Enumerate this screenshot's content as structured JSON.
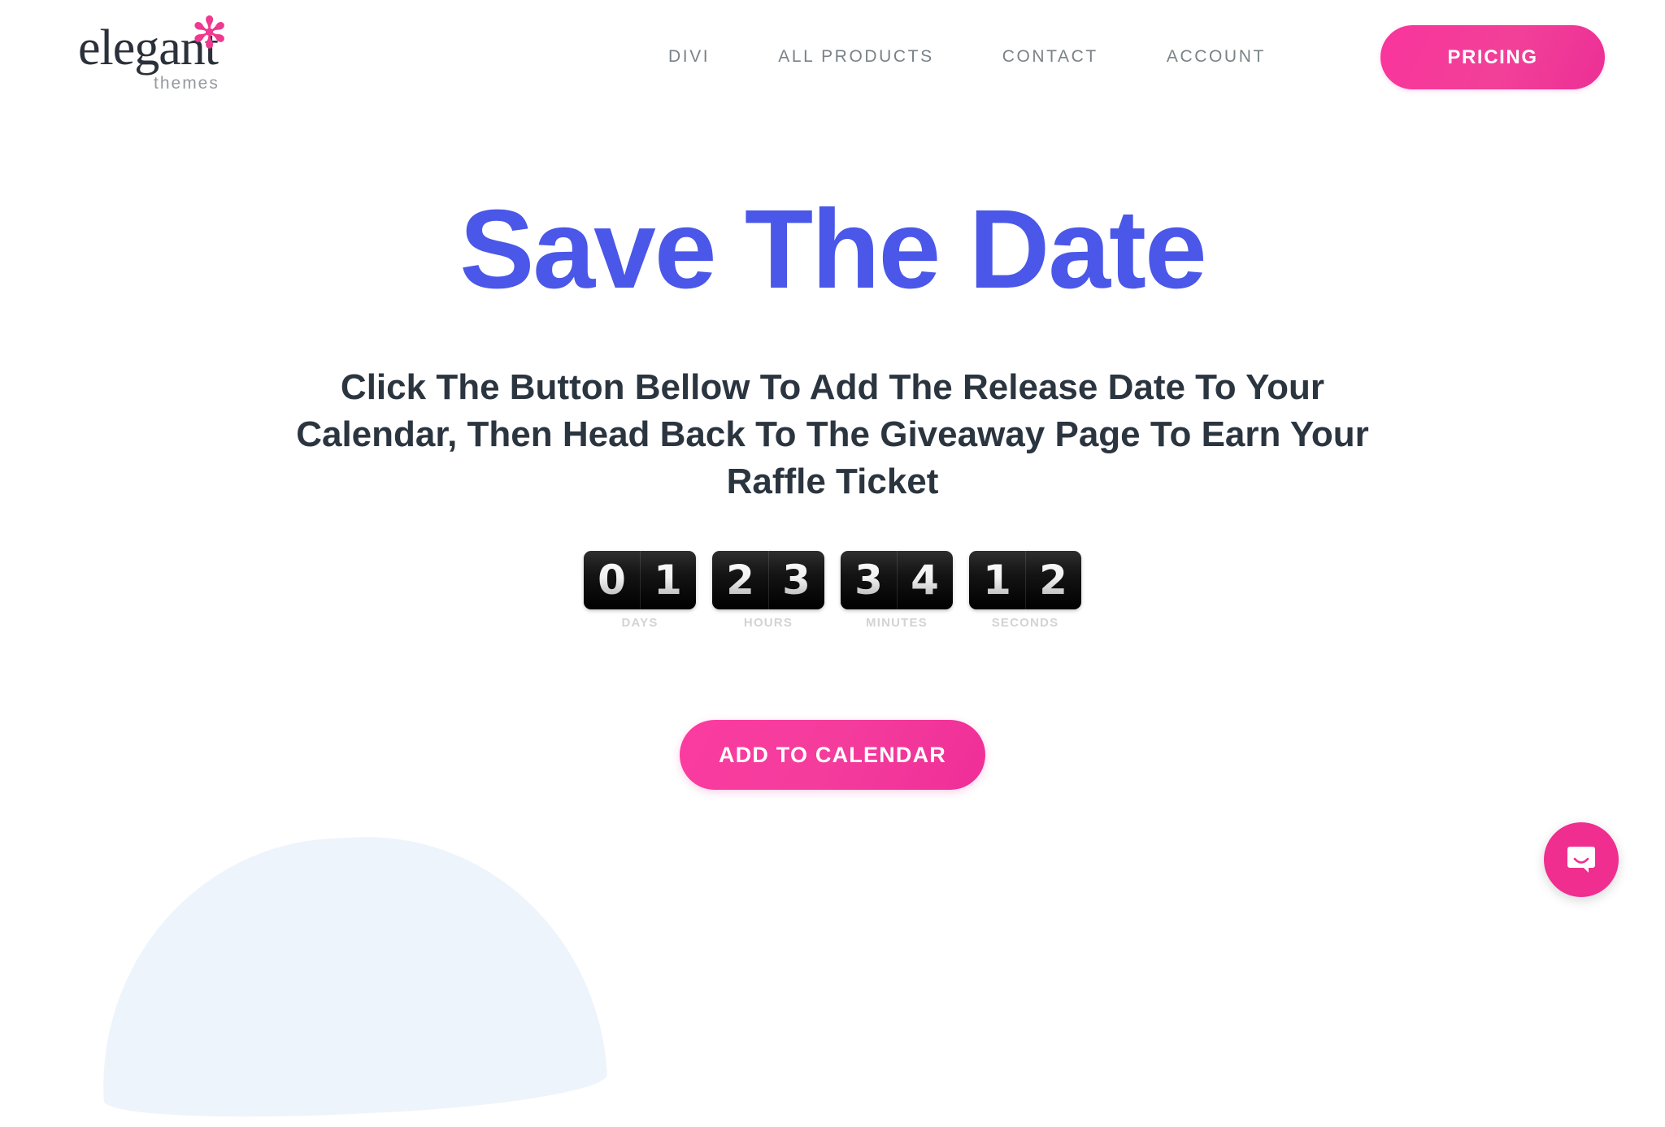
{
  "brand": {
    "logo_word": "elegant",
    "logo_star": "✻",
    "logo_sub": "themes",
    "accent_pink": "#ef2e98",
    "accent_blue": "#4a57e8",
    "text_dark": "#2b3540",
    "nav_gray": "#7a8287",
    "blob_blue": "#eef4fc"
  },
  "header": {
    "nav": [
      {
        "label": "DIVI",
        "name": "nav-item-divi"
      },
      {
        "label": "ALL PRODUCTS",
        "name": "nav-item-all-products"
      },
      {
        "label": "CONTACT",
        "name": "nav-item-contact"
      },
      {
        "label": "ACCOUNT",
        "name": "nav-item-account"
      }
    ],
    "pricing_label": "PRICING"
  },
  "hero": {
    "headline": "Save The Date",
    "subheadline": "Click The Button Bellow To Add The Release Date To Your Calendar, Then Head Back To The Giveaway Page To Earn Your Raffle Ticket",
    "cta_label": "ADD TO CALENDAR"
  },
  "countdown": {
    "units": [
      {
        "label": "DAYS",
        "value": "01",
        "d1": "0",
        "d2": "1"
      },
      {
        "label": "HOURS",
        "value": "23",
        "d1": "2",
        "d2": "3"
      },
      {
        "label": "MINUTES",
        "value": "34",
        "d1": "3",
        "d2": "4"
      },
      {
        "label": "SECONDS",
        "value": "12",
        "d1": "1",
        "d2": "2"
      }
    ]
  },
  "chat": {
    "icon": "chat-bubble-icon"
  }
}
